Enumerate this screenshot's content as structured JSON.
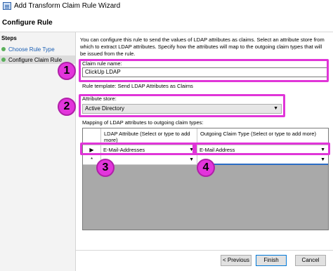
{
  "window": {
    "title": "Add Transform Claim Rule Wizard"
  },
  "page": {
    "title": "Configure Rule"
  },
  "steps": {
    "title": "Steps",
    "items": [
      {
        "label": "Choose Rule Type"
      },
      {
        "label": "Configure Claim Rule"
      }
    ]
  },
  "intro": "You can configure this rule to send the values of LDAP attributes as claims. Select an attribute store from which to extract LDAP attributes. Specify how the attributes will map to the outgoing claim types that will be issued from the rule.",
  "claim_rule_name": {
    "label": "Claim rule name:",
    "value": "ClickUp LDAP"
  },
  "rule_template": "Rule template: Send LDAP Attributes as Claims",
  "attribute_store": {
    "label": "Attribute store:",
    "value": "Active Directory"
  },
  "mapping": {
    "label": "Mapping of LDAP attributes to outgoing claim types:",
    "col_ldap": "LDAP Attribute (Select or type to add more)",
    "col_claim": "Outgoing Claim Type (Select or type to add more)",
    "rows": [
      {
        "marker": "▶",
        "ldap": "E-Mail-Addresses",
        "claim": "E-Mail Address"
      },
      {
        "marker": "*",
        "ldap": "",
        "claim": ""
      }
    ]
  },
  "annotations": [
    "1",
    "2",
    "3",
    "4"
  ],
  "buttons": {
    "previous": "< Previous",
    "finish": "Finish",
    "cancel": "Cancel"
  },
  "colors": {
    "highlight": "#e035d8",
    "badge": "#e335dc"
  }
}
